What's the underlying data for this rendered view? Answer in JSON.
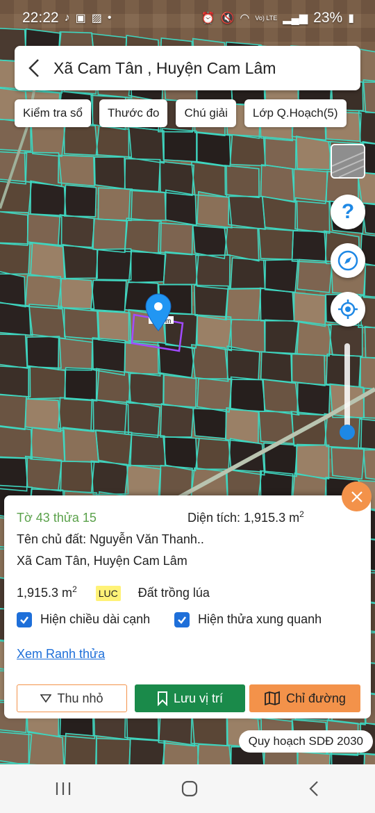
{
  "status": {
    "time": "22:22",
    "battery": "23%",
    "net": "Vo) LTE"
  },
  "header": {
    "title": "Xã Cam Tân , Huyện Cam Lâm"
  },
  "chips": [
    "Kiểm tra sổ",
    "Thước đo",
    "Chú giải",
    "Lớp Q.Hoạch(5)"
  ],
  "map": {
    "parcel_label": "m"
  },
  "panel": {
    "parcel_id": "Tờ 43 thửa 15",
    "area_label": "Diện tích: 1,915.3 m",
    "area_sup": "2",
    "owner": "Tên chủ đất: Nguyễn Văn Thanh..",
    "address": "Xã Cam Tân, Huyện Cam Lâm",
    "area_value": "1,915.3 m",
    "area_value_sup": "2",
    "land_code": "LUC",
    "land_type": "Đất trồng lúa",
    "checkbox_edges": "Hiện chiều dài cạnh",
    "checkbox_neighbors": "Hiện thửa xung quanh",
    "link_boundary": "Xem Ranh thửa",
    "btn_minimize": "Thu nhỏ",
    "btn_save": "Lưu vị trí",
    "btn_directions": "Chỉ đường"
  },
  "planning_label": "Quy hoạch SDĐ 2030",
  "colors": {
    "accent_green": "#1a8a4a",
    "accent_orange": "#f3924a",
    "link_blue": "#1e6fd9",
    "parcel_lines": "#3fd6c0"
  }
}
